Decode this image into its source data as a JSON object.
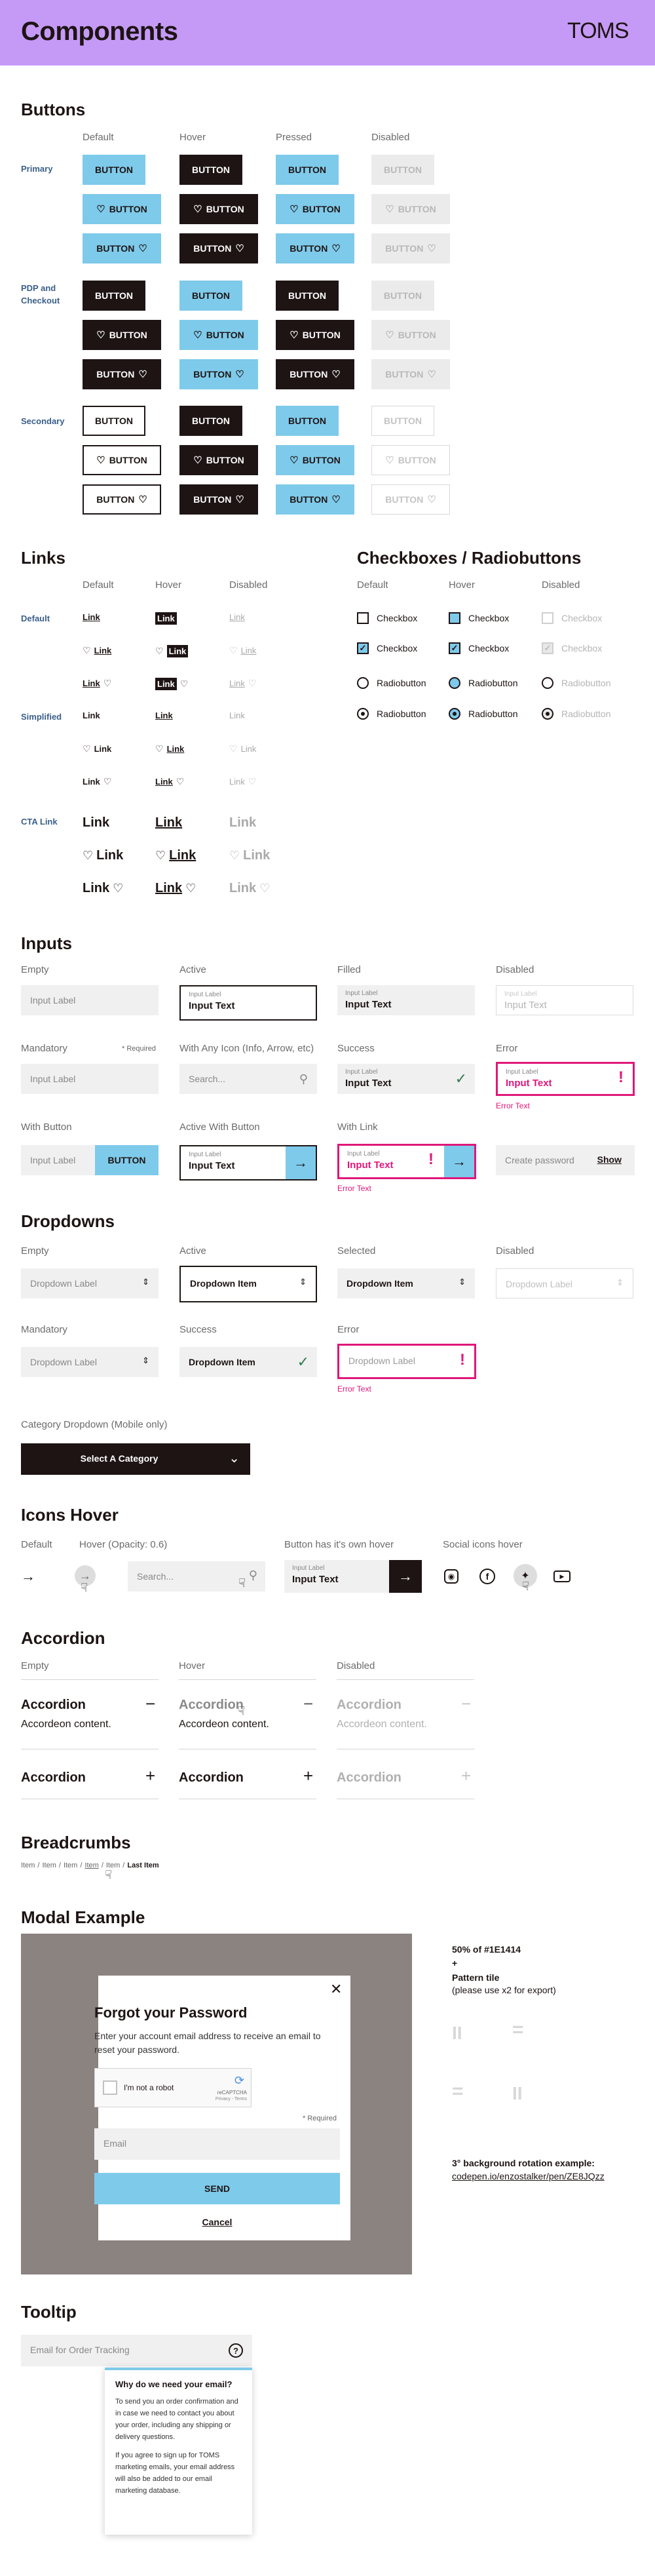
{
  "header": {
    "title": "Components",
    "brand": "TOMS"
  },
  "buttons": {
    "title": "Buttons",
    "cols": [
      "Default",
      "Hover",
      "Pressed",
      "Disabled"
    ],
    "rows": [
      "Primary",
      "PDP and Checkout",
      "Secondary"
    ],
    "label": "BUTTON"
  },
  "links": {
    "title": "Links",
    "cols": [
      "Default",
      "Hover",
      "Disabled"
    ],
    "rows": [
      "Default",
      "Simplified",
      "CTA Link"
    ],
    "label": "Link"
  },
  "checks": {
    "title": "Checkboxes / Radiobuttons",
    "cols": [
      "Default",
      "Hover",
      "Disabled"
    ],
    "checkbox": "Checkbox",
    "radiobutton": "Radiobutton"
  },
  "inputs": {
    "title": "Inputs",
    "labels": [
      "Empty",
      "Active",
      "Filled",
      "Disabled",
      "Mandatory",
      "With Any Icon (Info, Arrow, etc)",
      "Success",
      "Error",
      "With Button",
      "Active With Button",
      "With Link"
    ],
    "input_label": "Input Label",
    "input_text": "Input Text",
    "required": "* Required",
    "search": "Search...",
    "error_text": "Error Text",
    "button": "BUTTON",
    "create_password": "Create password",
    "show": "Show"
  },
  "dropdowns": {
    "title": "Dropdowns",
    "labels": [
      "Empty",
      "Active",
      "Selected",
      "Disabled",
      "Mandatory",
      "Success",
      "Error",
      "Category Dropdown (Mobile only)"
    ],
    "dropdown_label": "Dropdown Label",
    "dropdown_item": "Dropdown Item",
    "error_text": "Error Text",
    "category": "Select A Category"
  },
  "icons_hover": {
    "title": "Icons Hover",
    "labels": [
      "Default",
      "Hover (Opacity: 0.6)",
      "Button has it's own hover",
      "Social icons hover"
    ],
    "search": "Search...",
    "input_label": "Input Label",
    "input_text": "Input Text"
  },
  "accordion": {
    "title": "Accordion",
    "cols": [
      "Empty",
      "Hover",
      "Disabled"
    ],
    "title_text": "Accordion",
    "content": "Accordeon content."
  },
  "breadcrumbs": {
    "title": "Breadcrumbs",
    "items": [
      "Item",
      "Item",
      "Item",
      "Item",
      "Item"
    ],
    "last": "Last Item"
  },
  "modal": {
    "title": "Modal Example",
    "dialog_title": "Forgot your Password",
    "desc": "Enter your account email address to receive an email to reset your password.",
    "captcha": "I'm not a robot",
    "captcha_brand": "reCAPTCHA",
    "captcha_links": "Privacy - Terms",
    "required": "* Required",
    "email": "Email",
    "send": "SEND",
    "cancel": "Cancel",
    "overlay_note": "50% of #1E1414",
    "plus": "+",
    "pattern_note": "Pattern tile",
    "pattern_sub": "(please use x2 for export)",
    "rotation_note": "3° background rotation example:",
    "rotation_link": "codepen.io/enzostalker/pen/ZE8JQzz"
  },
  "tooltip": {
    "title": "Tooltip",
    "placeholder": "Email for Order Tracking",
    "heading": "Why do we need your email?",
    "p1": "To send you an order confirmation and in case we need to contact you about your order, including any shipping or delivery questions.",
    "p2": "If you agree to sign up for TOMS marketing emails, your email address will also be added to our email marketing database."
  }
}
